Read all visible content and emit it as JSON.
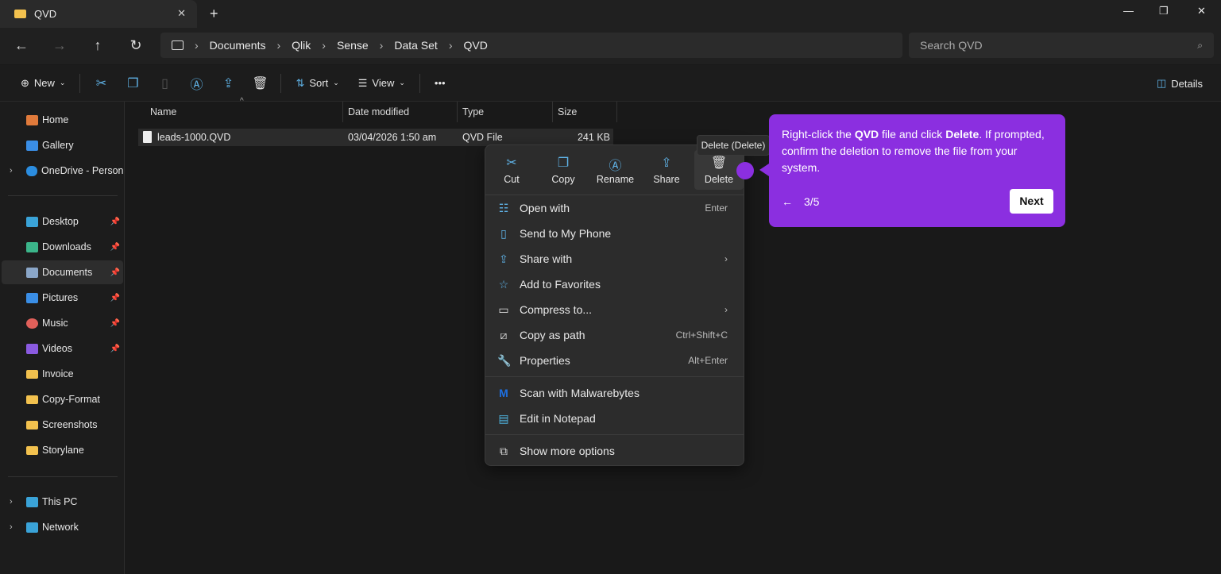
{
  "window": {
    "tab_title": "QVD",
    "new_tab": "+",
    "minimize": "—",
    "maximize": "❐",
    "close": "✕"
  },
  "nav": {
    "back": "←",
    "forward": "→",
    "up": "↑",
    "refresh": "↻"
  },
  "breadcrumb": [
    "Documents",
    "Qlik",
    "Sense",
    "Data Set",
    "QVD"
  ],
  "search": {
    "placeholder": "Search QVD"
  },
  "toolbar": {
    "new": "New",
    "sort": "Sort",
    "view": "View",
    "more": "•••",
    "details": "Details"
  },
  "sidebar": {
    "items": [
      {
        "label": "Home",
        "color": "#e07a3b"
      },
      {
        "label": "Gallery",
        "color": "#3a8ee6"
      },
      {
        "label": "OneDrive - Persona",
        "color": "#2b8de0"
      },
      {
        "label": "Desktop",
        "color": "#3aa3d8"
      },
      {
        "label": "Downloads",
        "color": "#3bb58a"
      },
      {
        "label": "Documents",
        "color": "#8aa6c8"
      },
      {
        "label": "Pictures",
        "color": "#3a8ee6"
      },
      {
        "label": "Music",
        "color": "#e0605a"
      },
      {
        "label": "Videos",
        "color": "#8a5ae0"
      },
      {
        "label": "Invoice",
        "color": "#f2c14e"
      },
      {
        "label": "Copy-Format",
        "color": "#f2c14e"
      },
      {
        "label": "Screenshots",
        "color": "#f2c14e"
      },
      {
        "label": "Storylane",
        "color": "#f2c14e"
      },
      {
        "label": "This PC",
        "color": "#3aa3d8"
      },
      {
        "label": "Network",
        "color": "#3aa3d8"
      }
    ]
  },
  "columns": {
    "name": "Name",
    "date": "Date modified",
    "type": "Type",
    "size": "Size"
  },
  "files": [
    {
      "name": "leads-1000.QVD",
      "date": "03/04/2026 1:50 am",
      "type": "QVD File",
      "size": "241 KB"
    }
  ],
  "context_menu": {
    "quick_actions": [
      "Cut",
      "Copy",
      "Rename",
      "Share",
      "Delete"
    ],
    "items": [
      {
        "label": "Open with",
        "shortcut": "Enter"
      },
      {
        "label": "Send to My Phone",
        "shortcut": ""
      },
      {
        "label": "Share with",
        "shortcut": "›"
      },
      {
        "label": "Add to Favorites",
        "shortcut": ""
      },
      {
        "label": "Compress to...",
        "shortcut": "›"
      },
      {
        "label": "Copy as path",
        "shortcut": "Ctrl+Shift+C"
      },
      {
        "label": "Properties",
        "shortcut": "Alt+Enter"
      },
      {
        "label": "Scan with Malwarebytes",
        "shortcut": ""
      },
      {
        "label": "Edit in Notepad",
        "shortcut": ""
      },
      {
        "label": "Show more options",
        "shortcut": ""
      }
    ]
  },
  "tooltip": "Delete (Delete)",
  "guide": {
    "pre": "Right-click the ",
    "b1": "QVD",
    "mid": " file and click ",
    "b2": "Delete",
    "post": ". If prompted, confirm the deletion to remove the file from your system.",
    "back": "←",
    "step": "3/5",
    "next": "Next",
    "color": "#8b2fe0"
  }
}
